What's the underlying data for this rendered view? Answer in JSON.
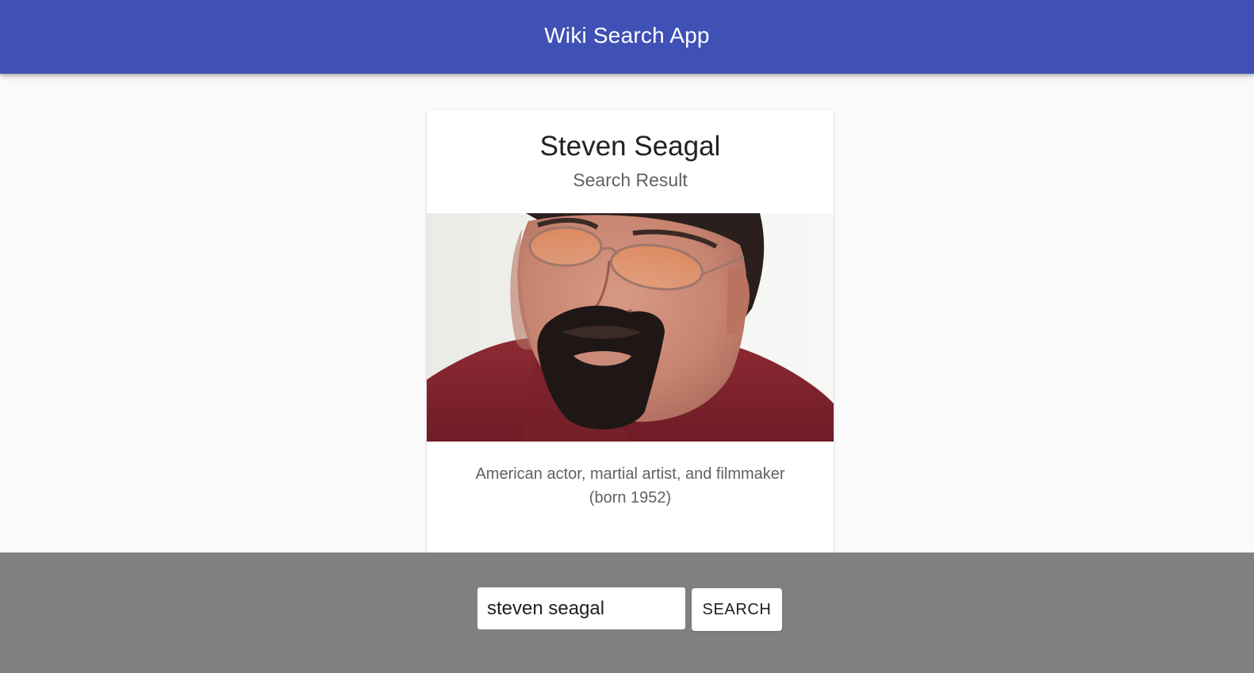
{
  "app_bar": {
    "title": "Wiki Search App"
  },
  "result_card": {
    "title": "Steven Seagal",
    "subtitle": "Search Result",
    "description": "American actor, martial artist, and filmmaker (born 1952)"
  },
  "search": {
    "value": "steven seagal",
    "button_label": "SEARCH"
  },
  "colors": {
    "app_bar": "#3f51b5",
    "bottom_bar": "#808080",
    "page_background": "#fafafa"
  }
}
